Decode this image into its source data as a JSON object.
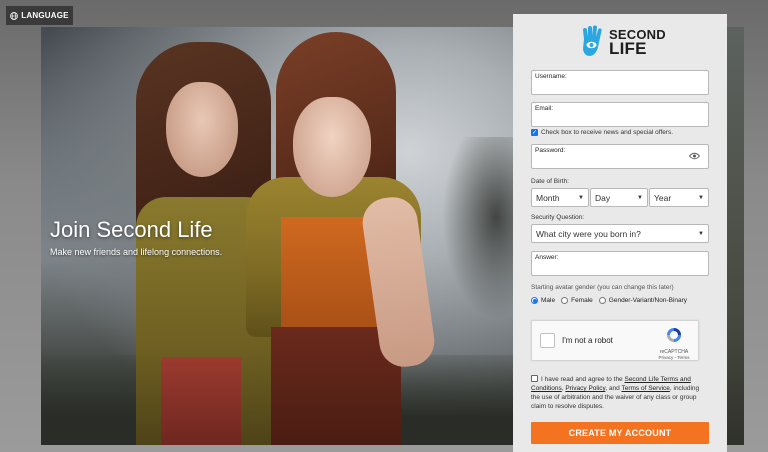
{
  "header": {
    "language_label": "LANGUAGE"
  },
  "hero": {
    "title": "Join Second Life",
    "subtitle": "Make new friends and lifelong connections."
  },
  "logo": {
    "line1": "SECOND",
    "line2": "LIFE",
    "color": "#2aa6e0"
  },
  "form": {
    "username_label": "Username:",
    "email_label": "Email:",
    "news_checkbox_label": "Check box to receive news and special offers.",
    "news_checked": true,
    "password_label": "Password:",
    "dob_label": "Date of Birth:",
    "dob_month": "Month",
    "dob_day": "Day",
    "dob_year": "Year",
    "security_label": "Security Question:",
    "security_value": "What city were you born in?",
    "answer_label": "Answer:",
    "gender_label": "Starting avatar gender (you can change this later)",
    "gender_options": [
      "Male",
      "Female",
      "Gender-Variant/Non-Binary"
    ],
    "gender_selected": "Male",
    "captcha_text": "I'm not a robot",
    "captcha_brand": "reCAPTCHA",
    "captcha_links": "Privacy - Terms",
    "terms_prefix": "I have read and agree to the ",
    "terms_link1": "Second Life Terms and Conditions",
    "terms_sep1": ", ",
    "terms_link2": "Privacy Policy",
    "terms_sep2": ", and ",
    "terms_link3": "Terms of Service",
    "terms_suffix": ", including the use of arbitration and the waiver of any class or group claim to resolve disputes.",
    "submit_label": "CREATE MY ACCOUNT",
    "submit_color": "#f47321"
  }
}
